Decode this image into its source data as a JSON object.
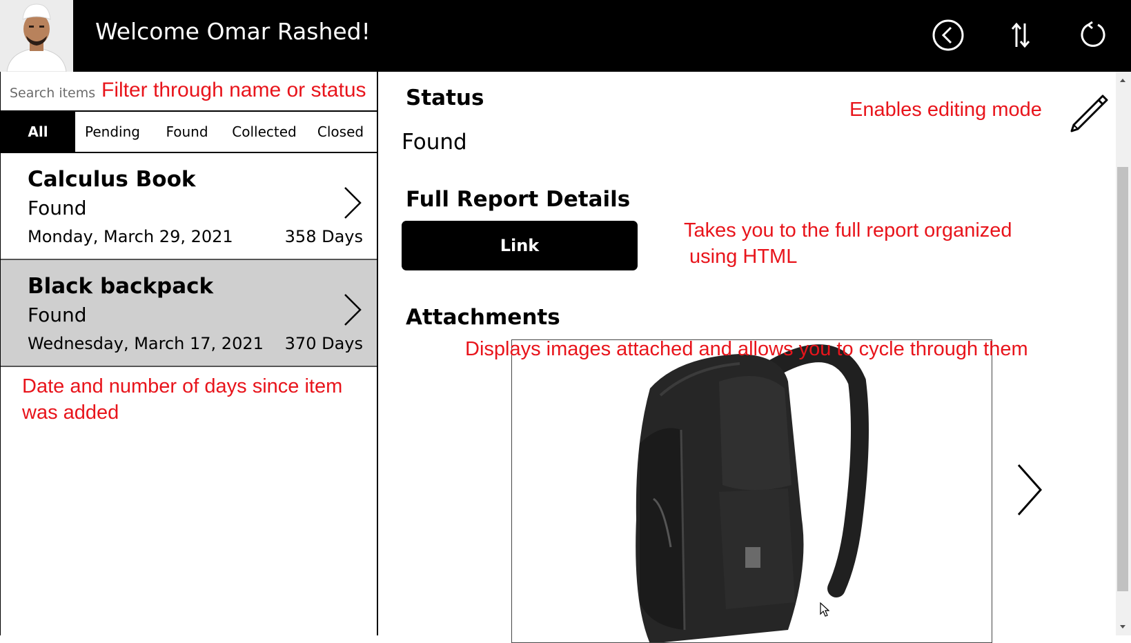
{
  "header": {
    "welcome": "Welcome Omar Rashed!",
    "icons": [
      "back-circle-icon",
      "sort-icon",
      "refresh-icon"
    ]
  },
  "search": {
    "placeholder": "Search items",
    "annotation": "Filter through name or status"
  },
  "tabs": [
    {
      "label": "All",
      "active": true
    },
    {
      "label": "Pending",
      "active": false
    },
    {
      "label": "Found",
      "active": false
    },
    {
      "label": "Collected",
      "active": false
    },
    {
      "label": "Closed",
      "active": false
    }
  ],
  "items": [
    {
      "name": "Calculus Book",
      "status": "Found",
      "date": "Monday, March 29, 2021",
      "days": "358 Days",
      "selected": false
    },
    {
      "name": "Black backpack",
      "status": "Found",
      "date": "Wednesday, March 17, 2021",
      "days": "370 Days",
      "selected": true
    }
  ],
  "left_annotation": {
    "line1": "Date and number of days since item",
    "line2": "was added"
  },
  "detail": {
    "status_heading": "Status",
    "status_value": "Found",
    "edit_annotation": "Enables editing mode",
    "report_heading": "Full Report Details",
    "link_label": "Link",
    "report_annotation_line1": "Takes you to the full report organized",
    "report_annotation_line2": "using HTML",
    "attachments_heading": "Attachments",
    "attachments_annotation": "Displays images attached and allows you to cycle through them"
  },
  "colors": {
    "annotation": "#e8141b",
    "header_bg": "#000000",
    "selected_row": "#cfcfcf"
  }
}
